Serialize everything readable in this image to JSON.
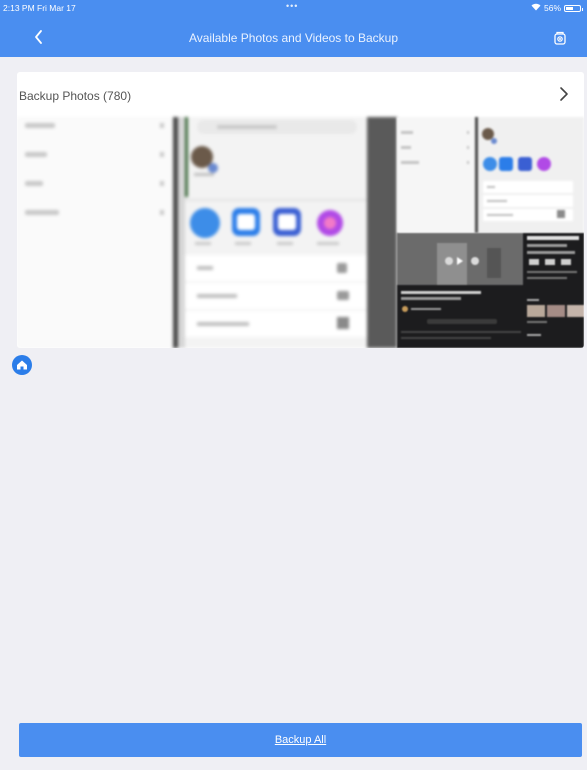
{
  "status_bar": {
    "time": "2:13 PM  Fri Mar 17",
    "dots": "•••",
    "battery": "56%",
    "battery_level": 0.56
  },
  "header": {
    "title": "Available Photos and Videos to Backup",
    "back_icon": "chevron-left-icon",
    "action_icon": "photo-backup-icon"
  },
  "section": {
    "label": "Backup Photos (780)",
    "chevron_icon": "chevron-right-icon"
  },
  "footer": {
    "button_label": "Backup All"
  },
  "colors": {
    "header_bg": "#4a8ef0",
    "page_bg": "#efeff4",
    "home_button": "#2b7de9"
  }
}
